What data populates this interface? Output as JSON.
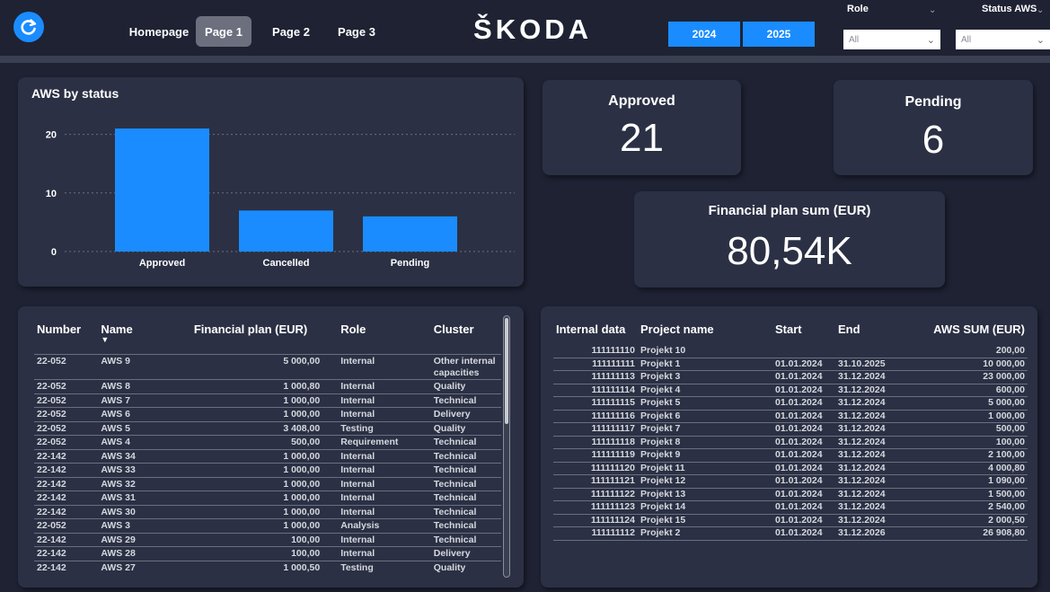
{
  "header": {
    "logo": "ŠKODA",
    "nav": [
      "Homepage",
      "Page 1",
      "Page 2",
      "Page 3"
    ],
    "active_nav": "Page 1",
    "years": [
      "2024",
      "2025"
    ],
    "filters": [
      {
        "label": "Role",
        "value": "All"
      },
      {
        "label": "Status AWS",
        "value": "All"
      }
    ]
  },
  "status_chart": {
    "title": "AWS by status"
  },
  "chart_data": {
    "type": "bar",
    "categories": [
      "Approved",
      "Cancelled",
      "Pending"
    ],
    "values": [
      21,
      7,
      6
    ],
    "ylim": [
      0,
      23
    ],
    "yticks": [
      0,
      10,
      20
    ],
    "grid": true,
    "bar_color": "#1a8cff"
  },
  "kpis": {
    "approved": {
      "label": "Approved",
      "value": "21"
    },
    "pending": {
      "label": "Pending",
      "value": "6"
    },
    "financial": {
      "label": "Financial plan sum (EUR)",
      "value": "80,54K"
    }
  },
  "aws_table": {
    "headers": [
      "Number",
      "Name",
      "Financial plan (EUR)",
      "Role",
      "Cluster"
    ],
    "rows": [
      [
        "22-052",
        "AWS 9",
        "5 000,00",
        "Internal",
        "Other internal capacities"
      ],
      [
        "22-052",
        "AWS 8",
        "1 000,80",
        "Internal",
        "Quality"
      ],
      [
        "22-052",
        "AWS 7",
        "1 000,00",
        "Internal",
        "Technical"
      ],
      [
        "22-052",
        "AWS 6",
        "1 000,00",
        "Internal",
        "Delivery"
      ],
      [
        "22-052",
        "AWS 5",
        "3 408,00",
        "Testing",
        "Quality"
      ],
      [
        "22-052",
        "AWS 4",
        "500,00",
        "Requirement",
        "Technical"
      ],
      [
        "22-142",
        "AWS 34",
        "1 000,00",
        "Internal",
        "Technical"
      ],
      [
        "22-142",
        "AWS 33",
        "1 000,00",
        "Internal",
        "Technical"
      ],
      [
        "22-142",
        "AWS 32",
        "1 000,00",
        "Internal",
        "Technical"
      ],
      [
        "22-142",
        "AWS 31",
        "1 000,00",
        "Internal",
        "Technical"
      ],
      [
        "22-142",
        "AWS 30",
        "1 000,00",
        "Internal",
        "Technical"
      ],
      [
        "22-052",
        "AWS 3",
        "1 000,00",
        "Analysis",
        "Technical"
      ],
      [
        "22-142",
        "AWS 29",
        "100,00",
        "Internal",
        "Technical"
      ],
      [
        "22-142",
        "AWS 28",
        "100,00",
        "Internal",
        "Delivery"
      ],
      [
        "22-142",
        "AWS 27",
        "1 000,50",
        "Testing",
        "Quality"
      ]
    ]
  },
  "project_table": {
    "headers": [
      "Internal data",
      "Project name",
      "Start",
      "End",
      "AWS SUM (EUR)"
    ],
    "rows": [
      [
        "111111110",
        "Projekt 10",
        "",
        "",
        "200,00"
      ],
      [
        "111111111",
        "Projekt 1",
        "01.01.2024",
        "31.10.2025",
        "10 000,00"
      ],
      [
        "111111113",
        "Projekt 3",
        "01.01.2024",
        "31.12.2024",
        "23 000,00"
      ],
      [
        "111111114",
        "Projekt 4",
        "01.01.2024",
        "31.12.2024",
        "600,00"
      ],
      [
        "111111115",
        "Projekt 5",
        "01.01.2024",
        "31.12.2024",
        "5 000,00"
      ],
      [
        "111111116",
        "Projekt 6",
        "01.01.2024",
        "31.12.2024",
        "1 000,00"
      ],
      [
        "111111117",
        "Projekt 7",
        "01.01.2024",
        "31.12.2024",
        "500,00"
      ],
      [
        "111111118",
        "Projekt 8",
        "01.01.2024",
        "31.12.2024",
        "100,00"
      ],
      [
        "111111119",
        "Projekt 9",
        "01.01.2024",
        "31.12.2024",
        "2 100,00"
      ],
      [
        "111111120",
        "Projekt 11",
        "01.01.2024",
        "31.12.2024",
        "4 000,80"
      ],
      [
        "111111121",
        "Projekt 12",
        "01.01.2024",
        "31.12.2024",
        "1 090,00"
      ],
      [
        "111111122",
        "Projekt 13",
        "01.01.2024",
        "31.12.2024",
        "1 500,00"
      ],
      [
        "111111123",
        "Projekt 14",
        "01.01.2024",
        "31.12.2024",
        "2 540,00"
      ],
      [
        "111111124",
        "Projekt 15",
        "01.01.2024",
        "31.12.2024",
        "2 000,50"
      ],
      [
        "111111112",
        "Projekt 2",
        "01.01.2024",
        "31.12.2026",
        "26 908,80"
      ]
    ]
  }
}
